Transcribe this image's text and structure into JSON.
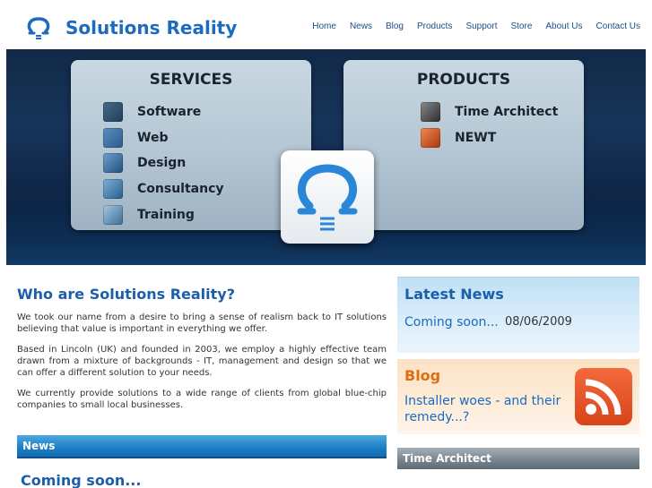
{
  "brand": {
    "name": "Solutions Reality"
  },
  "nav": [
    "Home",
    "News",
    "Blog",
    "Products",
    "Support",
    "Store",
    "About Us",
    "Contact Us"
  ],
  "banner": {
    "services_title": "SERVICES",
    "services": [
      {
        "label": "Software",
        "icon": "floppy-icon",
        "color": "#1f3c5c"
      },
      {
        "label": "Web",
        "icon": "web-icon",
        "color": "#2a5c8a"
      },
      {
        "label": "Design",
        "icon": "design-icon",
        "color": "#1f4f7c"
      },
      {
        "label": "Consultancy",
        "icon": "handshake-icon",
        "color": "#245e8c"
      },
      {
        "label": "Training",
        "icon": "brain-icon",
        "color": "#3b6d96"
      }
    ],
    "products_title": "PRODUCTS",
    "products": [
      {
        "label": "Time Architect",
        "icon": "time-architect-icon",
        "color": "#3a3a3a"
      },
      {
        "label": "NEWT",
        "icon": "newt-icon",
        "color": "#c2451a"
      }
    ]
  },
  "about": {
    "title": "Who are Solutions Reality?",
    "paragraphs": [
      "We took our name from a desire to bring a sense of realism back to IT solutions believing that value is important in everything we offer.",
      "Based in Lincoln (UK) and founded in 2003, we employ a highly effective team drawn from a mixture of backgrounds - IT, management and design so that we can offer a different solution to your needs.",
      "We currently provide solutions to a wide range of clients from global blue-chip companies to small local businesses."
    ]
  },
  "news_bar": "News",
  "news_coming": "Coming soon...",
  "latest_news": {
    "title": "Latest News",
    "link": "Coming soon...",
    "date": "08/06/2009"
  },
  "blog": {
    "title": "Blog",
    "link": "Installer woes - and their remedy...?",
    "icon": "rss-icon"
  },
  "time_architect_bar": "Time Architect",
  "colors": {
    "brand": "#1c6bbd",
    "blog_accent": "#e06c10",
    "banner": "#122a48"
  }
}
